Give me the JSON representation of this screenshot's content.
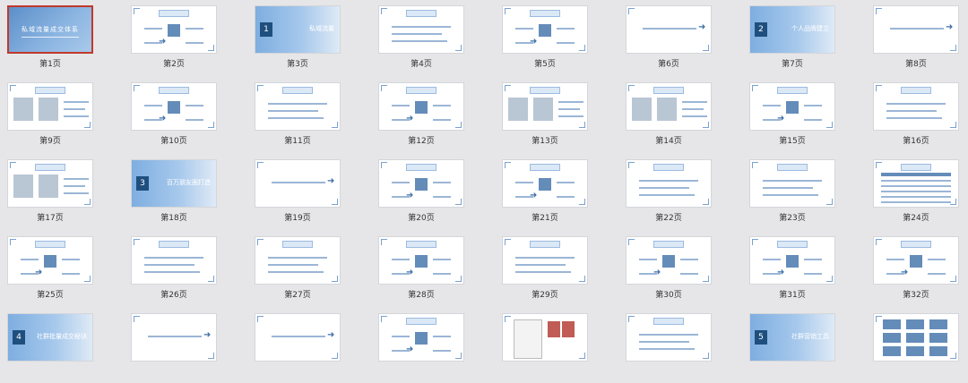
{
  "slides": [
    {
      "label": "第1页",
      "kind": "title",
      "text": "私域流量成交体系",
      "selected": true
    },
    {
      "label": "第2页",
      "kind": "diagram"
    },
    {
      "label": "第3页",
      "kind": "section",
      "num": "1",
      "text": "私域流量"
    },
    {
      "label": "第4页",
      "kind": "content"
    },
    {
      "label": "第5页",
      "kind": "diagram"
    },
    {
      "label": "第6页",
      "kind": "banner"
    },
    {
      "label": "第7页",
      "kind": "section",
      "num": "2",
      "text": "个人品牌建立"
    },
    {
      "label": "第8页",
      "kind": "banner"
    },
    {
      "label": "第9页",
      "kind": "photo"
    },
    {
      "label": "第10页",
      "kind": "diagram"
    },
    {
      "label": "第11页",
      "kind": "content"
    },
    {
      "label": "第12页",
      "kind": "diagram"
    },
    {
      "label": "第13页",
      "kind": "photo"
    },
    {
      "label": "第14页",
      "kind": "photo"
    },
    {
      "label": "第15页",
      "kind": "diagram"
    },
    {
      "label": "第16页",
      "kind": "content"
    },
    {
      "label": "第17页",
      "kind": "photo"
    },
    {
      "label": "第18页",
      "kind": "section",
      "num": "3",
      "text": "百万朋友圈打造"
    },
    {
      "label": "第19页",
      "kind": "banner"
    },
    {
      "label": "第20页",
      "kind": "diagram"
    },
    {
      "label": "第21页",
      "kind": "diagram"
    },
    {
      "label": "第22页",
      "kind": "content"
    },
    {
      "label": "第23页",
      "kind": "content"
    },
    {
      "label": "第24页",
      "kind": "table"
    },
    {
      "label": "第25页",
      "kind": "diagram"
    },
    {
      "label": "第26页",
      "kind": "content"
    },
    {
      "label": "第27页",
      "kind": "content"
    },
    {
      "label": "第28页",
      "kind": "diagram"
    },
    {
      "label": "第29页",
      "kind": "content"
    },
    {
      "label": "第30页",
      "kind": "diagram"
    },
    {
      "label": "第31页",
      "kind": "diagram"
    },
    {
      "label": "第32页",
      "kind": "diagram"
    },
    {
      "label": "",
      "kind": "section",
      "num": "4",
      "text": "社群批量成交秘诀"
    },
    {
      "label": "",
      "kind": "banner"
    },
    {
      "label": "",
      "kind": "banner"
    },
    {
      "label": "",
      "kind": "diagram"
    },
    {
      "label": "",
      "kind": "document"
    },
    {
      "label": "",
      "kind": "content"
    },
    {
      "label": "",
      "kind": "section",
      "num": "5",
      "text": "社群营销工具"
    },
    {
      "label": "",
      "kind": "grid"
    }
  ]
}
